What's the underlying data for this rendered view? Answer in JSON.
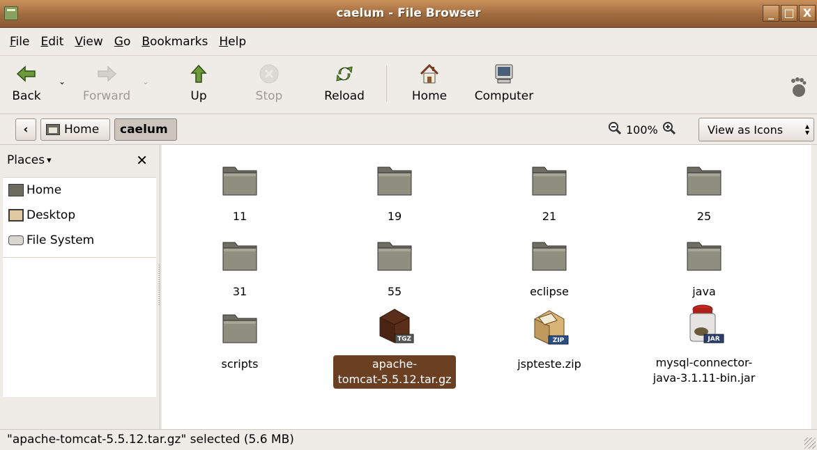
{
  "window": {
    "title": "caelum - File Browser",
    "btn_min": "_",
    "btn_max": "□",
    "btn_close": "X"
  },
  "menubar": [
    {
      "label": "File",
      "key": "F",
      "rest": "ile"
    },
    {
      "label": "Edit",
      "key": "E",
      "rest": "dit"
    },
    {
      "label": "View",
      "key": "V",
      "rest": "iew"
    },
    {
      "label": "Go",
      "key": "G",
      "rest": "o"
    },
    {
      "label": "Bookmarks",
      "key": "B",
      "rest": "ookmarks"
    },
    {
      "label": "Help",
      "key": "H",
      "rest": "elp"
    }
  ],
  "toolbar": {
    "back": "Back",
    "forward": "Forward",
    "up": "Up",
    "stop": "Stop",
    "reload": "Reload",
    "home": "Home",
    "computer": "Computer"
  },
  "location": {
    "back_glyph": "‹",
    "home": "Home",
    "current": "caelum",
    "zoom": "100%",
    "view_as": "View as Icons"
  },
  "sidebar": {
    "header": "Places",
    "close": "✕",
    "items": [
      {
        "label": "Home",
        "icon": "home-folder-icon"
      },
      {
        "label": "Desktop",
        "icon": "desktop-icon"
      },
      {
        "label": "File System",
        "icon": "drive-icon"
      }
    ]
  },
  "files": [
    {
      "name": "11",
      "type": "folder"
    },
    {
      "name": "19",
      "type": "folder"
    },
    {
      "name": "21",
      "type": "folder"
    },
    {
      "name": "25",
      "type": "folder"
    },
    {
      "name": "31",
      "type": "folder"
    },
    {
      "name": "55",
      "type": "folder"
    },
    {
      "name": "eclipse",
      "type": "folder"
    },
    {
      "name": "java",
      "type": "folder"
    },
    {
      "name": "scripts",
      "type": "folder"
    },
    {
      "name": "apache-tomcat-5.5.12.tar.gz",
      "name_line1": "apache-",
      "name_line2": "tomcat-5.5.12.tar.gz",
      "type": "tgz",
      "badge": "TGZ",
      "selected": true
    },
    {
      "name": "jspteste.zip",
      "type": "zip",
      "badge": "ZIP"
    },
    {
      "name": "mysql-connector-java-3.1.11-bin.jar",
      "name_line1": "mysql-connector-",
      "name_line2": "java-3.1.11-bin.jar",
      "type": "jar",
      "badge": "JAR"
    }
  ],
  "status": "\"apache-tomcat-5.5.12.tar.gz\" selected (5.6 MB)",
  "colors": {
    "titlebar": "#9e6a3e",
    "selection": "#6b3f22",
    "folder": "#8a8a78"
  }
}
